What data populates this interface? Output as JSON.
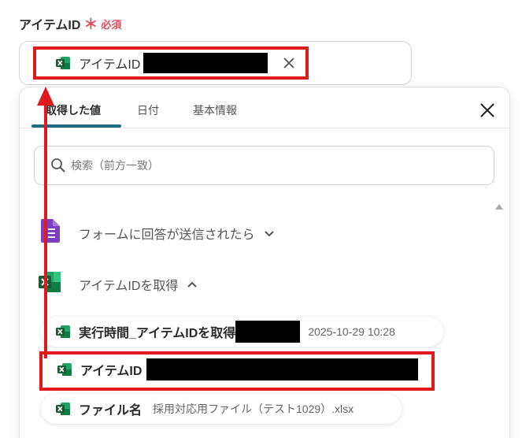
{
  "field": {
    "label": "アイテムID",
    "required_mark": "＊",
    "required_text": "必須",
    "chip_label": "アイテムID"
  },
  "tabs": [
    {
      "label": "取得した値",
      "active": true
    },
    {
      "label": "日付",
      "active": false
    },
    {
      "label": "基本情報",
      "active": false
    }
  ],
  "search": {
    "placeholder": "検索（前方一致）"
  },
  "sections": [
    {
      "title": "フォームに回答が送信されたら",
      "icon": "google-forms-icon",
      "expanded": false
    },
    {
      "title": "アイテムIDを取得",
      "icon": "excel-icon",
      "expanded": true
    }
  ],
  "rows": [
    {
      "label": "実行時間_アイテムIDを取得",
      "value": "2025-10-29 10:28"
    },
    {
      "label": "アイテムID",
      "value": ""
    },
    {
      "label": "ファイル名",
      "value": "採用対応用ファイル（テスト1029）.xlsx"
    }
  ],
  "colors": {
    "accent_teal": "#1c6e7f",
    "annotation_red": "#e0191c",
    "required_red": "#e24b5b",
    "excel_green": "#1f7a45",
    "forms_purple": "#7b3fc0"
  }
}
